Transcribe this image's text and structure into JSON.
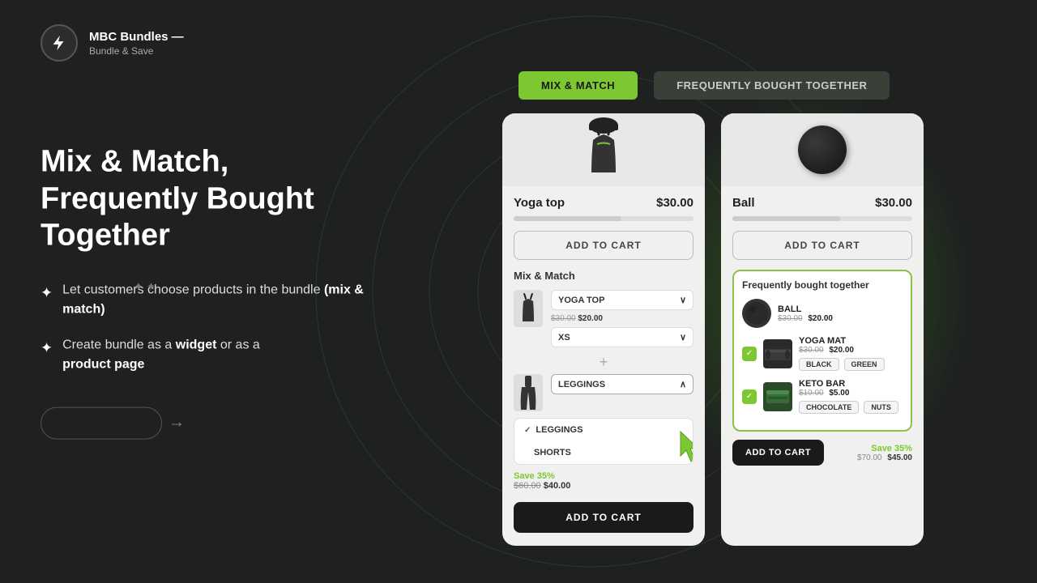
{
  "brand": {
    "name": "MBC Bundles —",
    "tagline": "Bundle & Save"
  },
  "hero": {
    "title_line1": "Mix & Match,",
    "title_line2": "Frequently Bought Together",
    "features": [
      {
        "text_before": "Let customers choose products in the bundle ",
        "text_bold": "(mix & match)",
        "text_after": ""
      },
      {
        "text_before": "Create bundle as a ",
        "text_bold": "widget",
        "text_mid": " or as a ",
        "text_bold2": "product page",
        "text_after": ""
      }
    ]
  },
  "tabs": {
    "mix_match": "MIX & MATCH",
    "fbt": "FREQUENTLY BOUGHT TOGETHER"
  },
  "mix_match_card": {
    "product_name": "Yoga top",
    "price": "$30.00",
    "add_to_cart_label": "ADD TO CART",
    "section_label": "Mix & Match",
    "item1": {
      "name": "YOGA TOP",
      "old_price": "$30.00",
      "new_price": "$20.00",
      "variant": "XS"
    },
    "item2": {
      "name": "LEGGINGS",
      "options": [
        "LEGGINGS",
        "SHORTS"
      ]
    },
    "save_label": "Save 35%",
    "original_total": "$60.00",
    "discounted_total": "$40.00",
    "final_add_label": "ADD TO CART"
  },
  "fbt_card": {
    "product_name": "Ball",
    "price": "$30.00",
    "add_to_cart_label": "ADD TO CART",
    "fbt_section_title": "Frequently bought together",
    "items": [
      {
        "name": "BALL",
        "old_price": "$30.00",
        "new_price": "$20.00",
        "type": "ball",
        "checked": false
      },
      {
        "name": "YOGA MAT",
        "old_price": "$30.00",
        "new_price": "$20.00",
        "type": "mat",
        "checked": true,
        "variants": [
          "BLACK",
          "GREEN"
        ]
      },
      {
        "name": "KETO BAR",
        "old_price": "$10.00",
        "new_price": "$5.00",
        "type": "bar",
        "checked": true,
        "variants": [
          "CHOCOLATE",
          "NUTS"
        ]
      }
    ],
    "save_label": "Save 35%",
    "original_total": "$70.00",
    "discounted_total": "$45.00",
    "add_cart_label": "ADD TO CART"
  }
}
